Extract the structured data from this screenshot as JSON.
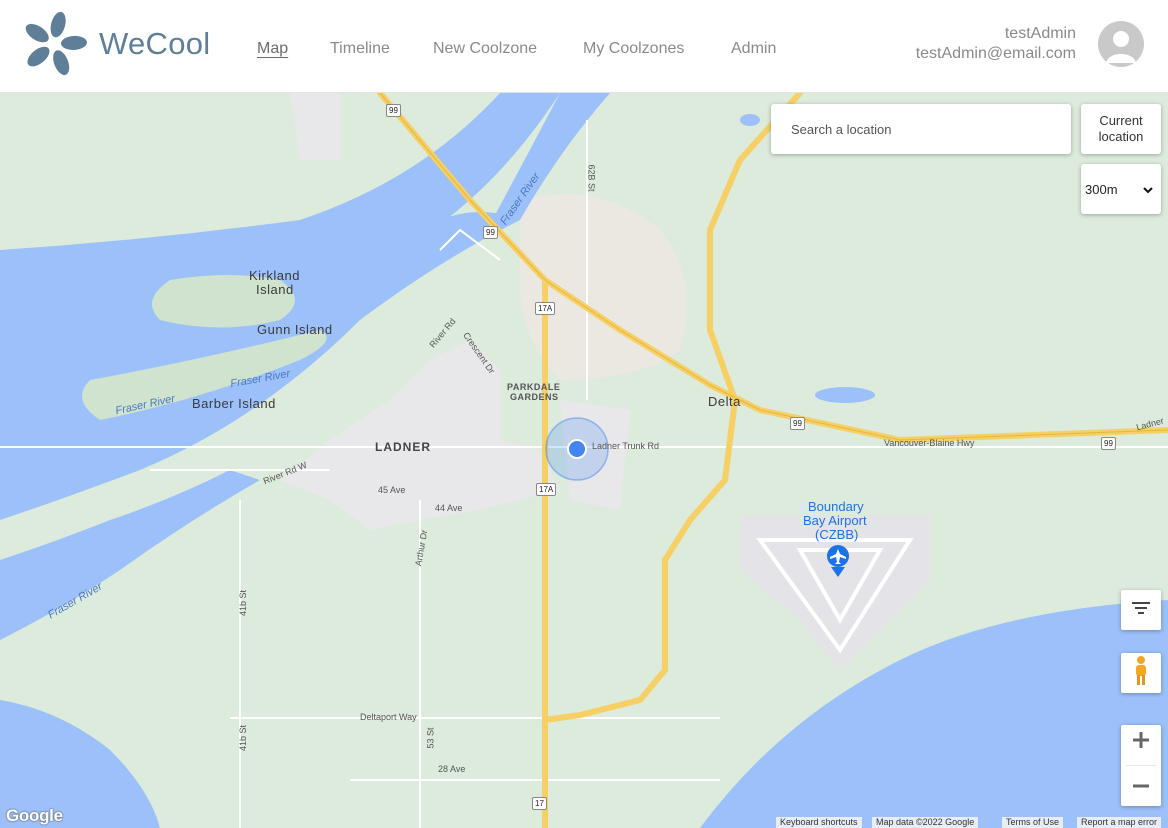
{
  "app": {
    "brand": "WeCool",
    "logo_icon": "flower-logo-icon",
    "accent_color": "#5f7f99"
  },
  "nav": {
    "items": [
      {
        "label": "Map",
        "active": true
      },
      {
        "label": "Timeline",
        "active": false
      },
      {
        "label": "New Coolzone",
        "active": false
      },
      {
        "label": "My Coolzones",
        "active": false
      },
      {
        "label": "Admin",
        "active": false
      }
    ]
  },
  "user": {
    "name": "testAdmin",
    "email": "testAdmin@email.com",
    "avatar_icon": "user-avatar-icon"
  },
  "map_controls": {
    "search_placeholder": "Search a location",
    "current_location_label_1": "Current",
    "current_location_label_2": "location",
    "radius_value": "300m",
    "filter_icon": "filter-icon",
    "pegman_icon": "street-view-pegman-icon",
    "zoom_in_icon": "plus-icon",
    "zoom_out_icon": "minus-icon"
  },
  "map": {
    "labels": {
      "kirkland_1": "Kirkland",
      "kirkland_2": "Island",
      "gunn": "Gunn Island",
      "barber": "Barber Island",
      "fraser_1": "Fraser River",
      "fraser_2": "Fraser River",
      "fraser_3": "Fraser River",
      "fraser_4": "Fraser River",
      "ladner": "LADNER",
      "parkdale_1": "PARKDALE",
      "parkdale_2": "GARDENS",
      "delta": "Delta",
      "airport_1": "Boundary",
      "airport_2": "Bay Airport",
      "airport_3": "(CZBB)",
      "river_rd_w": "River Rd W",
      "river_rd": "River Rd",
      "crescent_dr": "Crescent Dr",
      "ave45": "45 Ave",
      "ave44": "44 Ave",
      "arthur_dr": "Arthur Dr",
      "st41b_1": "41b St",
      "st41b_2": "41b St",
      "st53": "53 St",
      "st62b": "62B St",
      "ladner_trunk": "Ladner Trunk Rd",
      "vancouver_blaine": "Vancouver-Blaine Hwy",
      "deltaport": "Deltaport Way",
      "ave28": "28 Ave",
      "ladner_tr": "Ladner"
    },
    "shields": {
      "h99a": "99",
      "h99b": "99",
      "h99c": "99",
      "h99d": "99",
      "h17a_1": "17A",
      "h17a_2": "17A",
      "h17": "17"
    },
    "google": "Google",
    "attribution": {
      "shortcuts": "Keyboard shortcuts",
      "data": "Map data ©2022 Google",
      "terms": "Terms of Use",
      "report": "Report a map error"
    },
    "colors": {
      "land": "#dcebdc",
      "water": "#9cc0f9",
      "highway": "#f6cf65",
      "urban": "#e8e8ea",
      "location_dot": "#4285f4"
    }
  }
}
